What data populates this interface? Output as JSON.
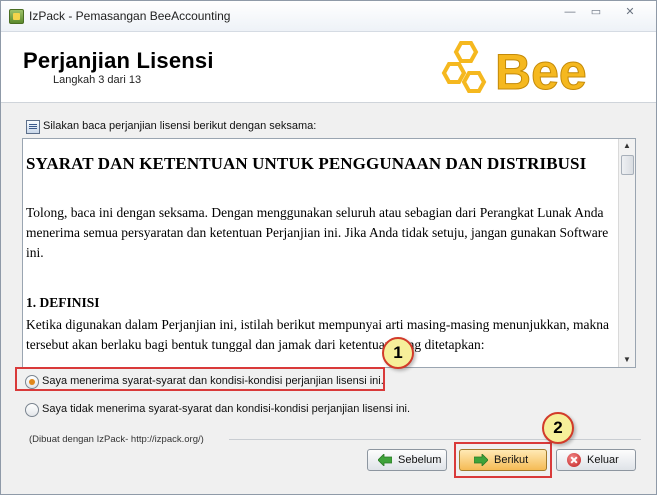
{
  "window": {
    "title": "IzPack - Pemasangan BeeAccounting",
    "controls": {
      "minimize": "—",
      "maximize": "▭",
      "close": "✕"
    }
  },
  "header": {
    "title": "Perjanjian Lisensi",
    "step": "Langkah 3 dari 13",
    "logo_text": "Bee",
    "logo_color": "#f5b81f"
  },
  "content": {
    "instruction": "Silakan baca perjanjian lisensi berikut dengan seksama:",
    "license": {
      "heading": "SYARAT DAN KETENTUAN UNTUK PENGGUNAAN DAN DISTRIBUSI",
      "paragraph1": "Tolong, baca ini dengan seksama. Dengan menggunakan seluruh atau sebagian dari Perangkat Lunak Anda menerima semua persyaratan dan ketentuan Perjanjian ini. Jika Anda tidak setuju, jangan gunakan Software ini.",
      "section1_title": "1. DEFINISI",
      "paragraph2": "Ketika digunakan dalam Perjanjian ini, istilah berikut mempunyai arti masing-masing menunjukkan, makna tersebut akan berlaku bagi bentuk tunggal dan jamak dari ketentuan yang ditetapkan:"
    },
    "options": [
      {
        "label": "Saya menerima syarat-syarat dan kondisi-kondisi perjanjian lisensi ini.",
        "selected": true
      },
      {
        "label": "Saya tidak menerima syarat-syarat dan kondisi-kondisi perjanjian lisensi ini.",
        "selected": false
      }
    ],
    "credit": "(Dibuat dengan IzPack- http://izpack.org/)"
  },
  "annotations": {
    "badge1": "1",
    "badge2": "2",
    "highlight_color": "#d93a3a"
  },
  "buttons": {
    "back": "Sebelum",
    "next": "Berikut",
    "quit": "Keluar"
  }
}
